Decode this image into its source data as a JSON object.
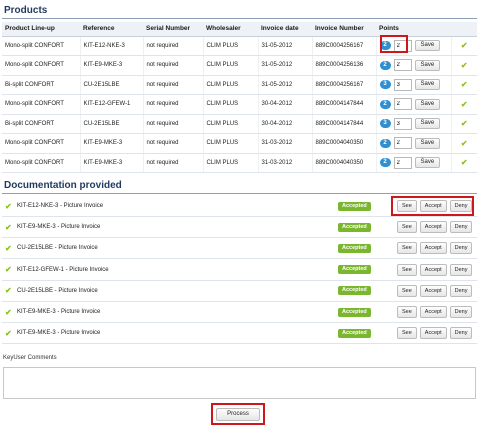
{
  "products": {
    "title": "Products",
    "columns": [
      "Product Line-up",
      "Reference",
      "Serial Number",
      "Wholesaler",
      "Invoice date",
      "Invoice Number",
      "Points",
      ""
    ],
    "rows": [
      {
        "line": "Mono-split CONFORT",
        "ref": "KIT-E12-NKE-3",
        "serial": "not required",
        "wholesaler": "CLIM PLUS",
        "date": "31-05-2012",
        "invoice": "889C0004256167",
        "badge": "2",
        "points": "2",
        "save": "Save"
      },
      {
        "line": "Mono-split CONFORT",
        "ref": "KIT-E9-MKE-3",
        "serial": "not required",
        "wholesaler": "CLIM PLUS",
        "date": "31-05-2012",
        "invoice": "889C0004256136",
        "badge": "2",
        "points": "2",
        "save": "Save"
      },
      {
        "line": "Bi-split CONFORT",
        "ref": "CU-2E15LBE",
        "serial": "not required",
        "wholesaler": "CLIM PLUS",
        "date": "31-05-2012",
        "invoice": "889C0004256167",
        "badge": "3",
        "points": "3",
        "save": "Save"
      },
      {
        "line": "Mono-split CONFORT",
        "ref": "KIT-E12-GFEW-1",
        "serial": "not required",
        "wholesaler": "CLIM PLUS",
        "date": "30-04-2012",
        "invoice": "889C0004147844",
        "badge": "2",
        "points": "2",
        "save": "Save"
      },
      {
        "line": "Bi-split CONFORT",
        "ref": "CU-2E15LBE",
        "serial": "not required",
        "wholesaler": "CLIM PLUS",
        "date": "30-04-2012",
        "invoice": "889C0004147844",
        "badge": "3",
        "points": "3",
        "save": "Save"
      },
      {
        "line": "Mono-split CONFORT",
        "ref": "KIT-E9-MKE-3",
        "serial": "not required",
        "wholesaler": "CLIM PLUS",
        "date": "31-03-2012",
        "invoice": "889C0004040350",
        "badge": "2",
        "points": "2",
        "save": "Save"
      },
      {
        "line": "Mono-split CONFORT",
        "ref": "KIT-E9-MKE-3",
        "serial": "not required",
        "wholesaler": "CLIM PLUS",
        "date": "31-03-2012",
        "invoice": "889C0004040350",
        "badge": "2",
        "points": "2",
        "save": "Save"
      }
    ]
  },
  "documentation": {
    "title": "Documentation provided",
    "items": [
      {
        "label": "KIT-E12-NKE-3 - Picture Invoice",
        "status": "Accepted",
        "see": "See",
        "accept": "Accept",
        "deny": "Deny"
      },
      {
        "label": "KIT-E9-MKE-3 - Picture Invoice",
        "status": "Accepted",
        "see": "See",
        "accept": "Accept",
        "deny": "Deny"
      },
      {
        "label": "CU-2E15LBE - Picture Invoice",
        "status": "Accepted",
        "see": "See",
        "accept": "Accept",
        "deny": "Deny"
      },
      {
        "label": "KIT-E12-GFEW-1 - Picture Invoice",
        "status": "Accepted",
        "see": "See",
        "accept": "Accept",
        "deny": "Deny"
      },
      {
        "label": "CU-2E15LBE - Picture Invoice",
        "status": "Accepted",
        "see": "See",
        "accept": "Accept",
        "deny": "Deny"
      },
      {
        "label": "KIT-E9-MKE-3 - Picture Invoice",
        "status": "Accepted",
        "see": "See",
        "accept": "Accept",
        "deny": "Deny"
      },
      {
        "label": "KIT-E9-MKE-3 - Picture Invoice",
        "status": "Accepted",
        "see": "See",
        "accept": "Accept",
        "deny": "Deny"
      }
    ]
  },
  "comments": {
    "label": "KeyUser Comments",
    "value": ""
  },
  "process_label": "Process",
  "icons": {
    "row_check": "check-icon",
    "points_badge": "badge"
  },
  "colors": {
    "highlight": "#d0161b",
    "accepted": "#7ab62e",
    "badge": "#2f8fd0",
    "check": "#8dc21f",
    "title": "#1f3a5f"
  }
}
